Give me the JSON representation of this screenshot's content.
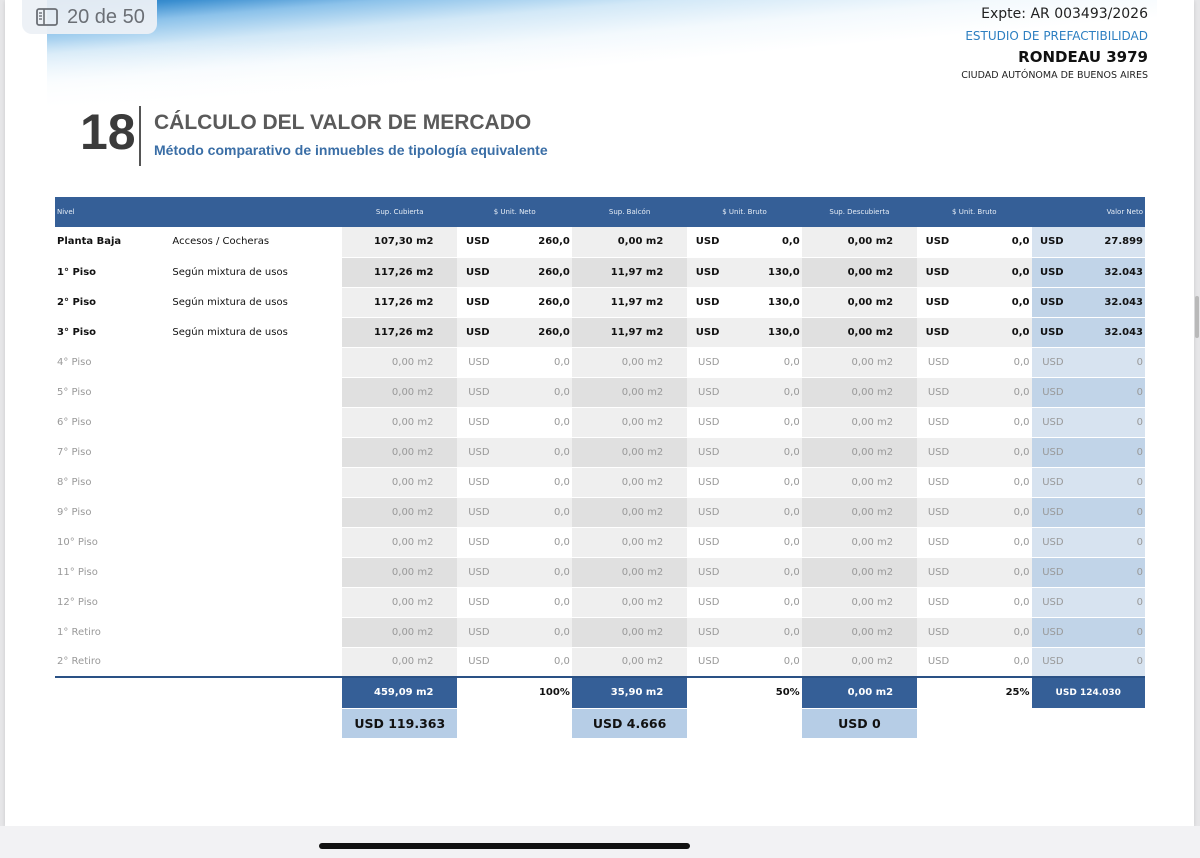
{
  "viewer": {
    "page_indicator": "20 de 50",
    "icon": "sidebar-icon"
  },
  "header": {
    "expte": "Expte: AR 003493/2026",
    "estudio": "ESTUDIO DE PREFACTIBILIDAD",
    "address": "RONDEAU 3979",
    "city": "CIUDAD AUTÓNOMA DE BUENOS AIRES"
  },
  "section": {
    "number": "18",
    "title": "CÁLCULO DEL VALOR DE MERCADO",
    "subtitle": "Método comparativo de inmuebles de tipología equivalente"
  },
  "table": {
    "columns": [
      "Nivel",
      "",
      "Sup. Cubierta",
      "$ Unit. Neto",
      "Sup. Balcón",
      "$ Unit. Bruto",
      "Sup. Descubierta",
      "$ Unit. Bruto",
      "Valor Neto"
    ],
    "rows": [
      {
        "nivel": "Planta Baja",
        "desc": "Accesos / Cocheras",
        "sup_cub": "107,30 m2",
        "usd1": "USD",
        "unit_neto": "260,0",
        "sup_bal": "0,00 m2",
        "usd2": "USD",
        "unit_bruto1": "0,0",
        "sup_desc": "0,00 m2",
        "usd3": "USD",
        "unit_bruto2": "0,0",
        "usd4": "USD",
        "valor_neto": "27.899"
      },
      {
        "nivel": "1° Piso",
        "desc": "Según mixtura de usos",
        "sup_cub": "117,26 m2",
        "usd1": "USD",
        "unit_neto": "260,0",
        "sup_bal": "11,97 m2",
        "usd2": "USD",
        "unit_bruto1": "130,0",
        "sup_desc": "0,00 m2",
        "usd3": "USD",
        "unit_bruto2": "0,0",
        "usd4": "USD",
        "valor_neto": "32.043"
      },
      {
        "nivel": "2° Piso",
        "desc": "Según mixtura de usos",
        "sup_cub": "117,26 m2",
        "usd1": "USD",
        "unit_neto": "260,0",
        "sup_bal": "11,97 m2",
        "usd2": "USD",
        "unit_bruto1": "130,0",
        "sup_desc": "0,00 m2",
        "usd3": "USD",
        "unit_bruto2": "0,0",
        "usd4": "USD",
        "valor_neto": "32.043"
      },
      {
        "nivel": "3° Piso",
        "desc": "Según mixtura de usos",
        "sup_cub": "117,26 m2",
        "usd1": "USD",
        "unit_neto": "260,0",
        "sup_bal": "11,97 m2",
        "usd2": "USD",
        "unit_bruto1": "130,0",
        "sup_desc": "0,00 m2",
        "usd3": "USD",
        "unit_bruto2": "0,0",
        "usd4": "USD",
        "valor_neto": "32.043"
      },
      {
        "nivel": "4° Piso",
        "desc": "",
        "sup_cub": "0,00 m2",
        "usd1": "USD",
        "unit_neto": "0,0",
        "sup_bal": "0,00 m2",
        "usd2": "USD",
        "unit_bruto1": "0,0",
        "sup_desc": "0,00 m2",
        "usd3": "USD",
        "unit_bruto2": "0,0",
        "usd4": "USD",
        "valor_neto": "0"
      },
      {
        "nivel": "5° Piso",
        "desc": "",
        "sup_cub": "0,00 m2",
        "usd1": "USD",
        "unit_neto": "0,0",
        "sup_bal": "0,00 m2",
        "usd2": "USD",
        "unit_bruto1": "0,0",
        "sup_desc": "0,00 m2",
        "usd3": "USD",
        "unit_bruto2": "0,0",
        "usd4": "USD",
        "valor_neto": "0"
      },
      {
        "nivel": "6° Piso",
        "desc": "",
        "sup_cub": "0,00 m2",
        "usd1": "USD",
        "unit_neto": "0,0",
        "sup_bal": "0,00 m2",
        "usd2": "USD",
        "unit_bruto1": "0,0",
        "sup_desc": "0,00 m2",
        "usd3": "USD",
        "unit_bruto2": "0,0",
        "usd4": "USD",
        "valor_neto": "0"
      },
      {
        "nivel": "7° Piso",
        "desc": "",
        "sup_cub": "0,00 m2",
        "usd1": "USD",
        "unit_neto": "0,0",
        "sup_bal": "0,00 m2",
        "usd2": "USD",
        "unit_bruto1": "0,0",
        "sup_desc": "0,00 m2",
        "usd3": "USD",
        "unit_bruto2": "0,0",
        "usd4": "USD",
        "valor_neto": "0"
      },
      {
        "nivel": "8° Piso",
        "desc": "",
        "sup_cub": "0,00 m2",
        "usd1": "USD",
        "unit_neto": "0,0",
        "sup_bal": "0,00 m2",
        "usd2": "USD",
        "unit_bruto1": "0,0",
        "sup_desc": "0,00 m2",
        "usd3": "USD",
        "unit_bruto2": "0,0",
        "usd4": "USD",
        "valor_neto": "0"
      },
      {
        "nivel": "9° Piso",
        "desc": "",
        "sup_cub": "0,00 m2",
        "usd1": "USD",
        "unit_neto": "0,0",
        "sup_bal": "0,00 m2",
        "usd2": "USD",
        "unit_bruto1": "0,0",
        "sup_desc": "0,00 m2",
        "usd3": "USD",
        "unit_bruto2": "0,0",
        "usd4": "USD",
        "valor_neto": "0"
      },
      {
        "nivel": "10° Piso",
        "desc": "",
        "sup_cub": "0,00 m2",
        "usd1": "USD",
        "unit_neto": "0,0",
        "sup_bal": "0,00 m2",
        "usd2": "USD",
        "unit_bruto1": "0,0",
        "sup_desc": "0,00 m2",
        "usd3": "USD",
        "unit_bruto2": "0,0",
        "usd4": "USD",
        "valor_neto": "0"
      },
      {
        "nivel": "11° Piso",
        "desc": "",
        "sup_cub": "0,00 m2",
        "usd1": "USD",
        "unit_neto": "0,0",
        "sup_bal": "0,00 m2",
        "usd2": "USD",
        "unit_bruto1": "0,0",
        "sup_desc": "0,00 m2",
        "usd3": "USD",
        "unit_bruto2": "0,0",
        "usd4": "USD",
        "valor_neto": "0"
      },
      {
        "nivel": "12° Piso",
        "desc": "",
        "sup_cub": "0,00 m2",
        "usd1": "USD",
        "unit_neto": "0,0",
        "sup_bal": "0,00 m2",
        "usd2": "USD",
        "unit_bruto1": "0,0",
        "sup_desc": "0,00 m2",
        "usd3": "USD",
        "unit_bruto2": "0,0",
        "usd4": "USD",
        "valor_neto": "0"
      },
      {
        "nivel": "1° Retiro",
        "desc": "",
        "sup_cub": "0,00 m2",
        "usd1": "USD",
        "unit_neto": "0,0",
        "sup_bal": "0,00 m2",
        "usd2": "USD",
        "unit_bruto1": "0,0",
        "sup_desc": "0,00 m2",
        "usd3": "USD",
        "unit_bruto2": "0,0",
        "usd4": "USD",
        "valor_neto": "0"
      },
      {
        "nivel": "2° Retiro",
        "desc": "",
        "sup_cub": "0,00 m2",
        "usd1": "USD",
        "unit_neto": "0,0",
        "sup_bal": "0,00 m2",
        "usd2": "USD",
        "unit_bruto1": "0,0",
        "sup_desc": "0,00 m2",
        "usd3": "USD",
        "unit_bruto2": "0,0",
        "usd4": "USD",
        "valor_neto": "0"
      }
    ],
    "totals": {
      "sup_cub": "459,09 m2",
      "pct1": "100%",
      "sup_bal": "35,90 m2",
      "pct2": "50%",
      "sup_desc": "0,00 m2",
      "pct3": "25%",
      "valor_neto": "USD 124.030"
    },
    "usd_totals": {
      "cubierta": "USD  119.363",
      "balcon": "USD  4.666",
      "descubierta": "USD  0"
    }
  }
}
